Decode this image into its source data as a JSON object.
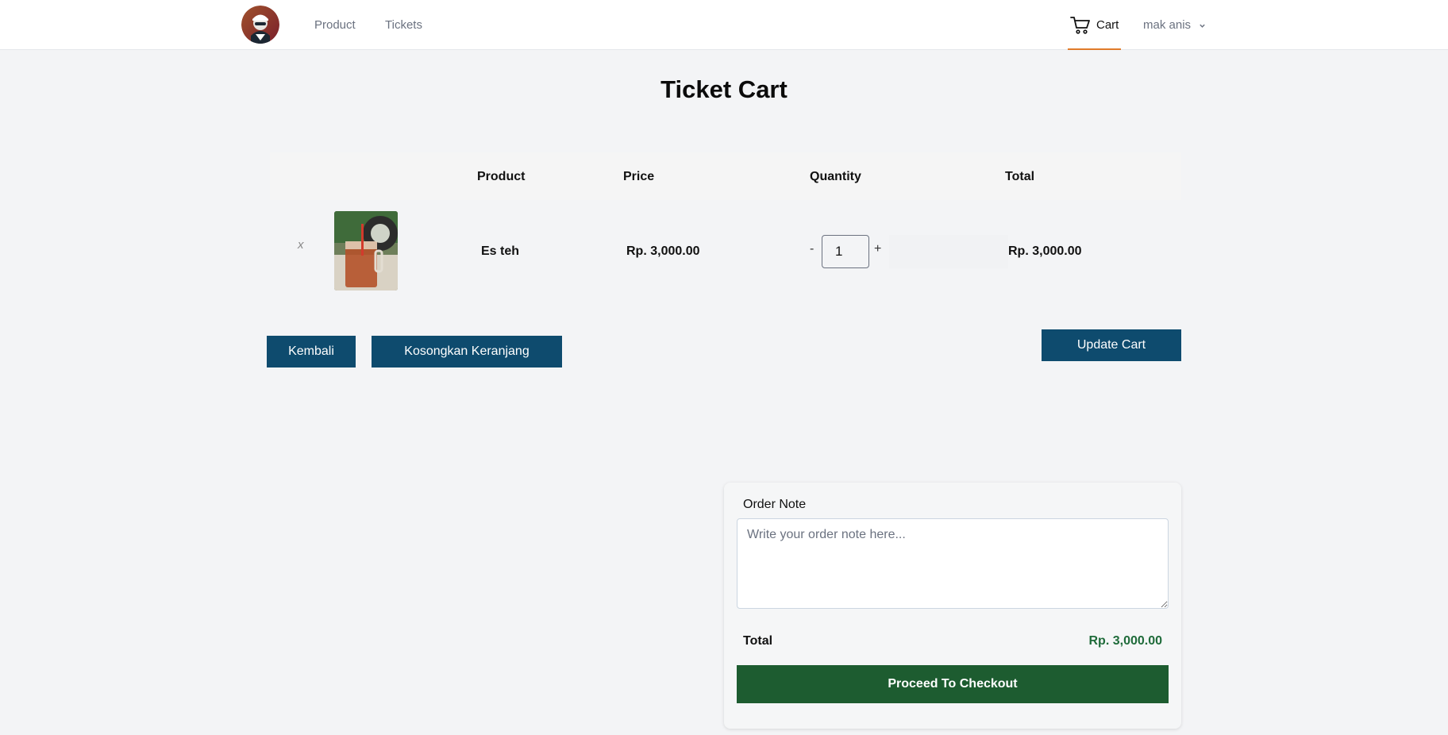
{
  "nav": {
    "product": "Product",
    "tickets": "Tickets",
    "cart": "Cart",
    "user": "mak anis"
  },
  "page": {
    "title": "Ticket Cart"
  },
  "table": {
    "headers": {
      "product": "Product",
      "price": "Price",
      "quantity": "Quantity",
      "total": "Total"
    },
    "rows": [
      {
        "remove": "x",
        "product": "Es teh",
        "price": "Rp. 3,000.00",
        "quantity": "1",
        "total": "Rp. 3,000.00"
      }
    ],
    "qty_minus": "-",
    "qty_plus": "+"
  },
  "actions": {
    "back": "Kembali",
    "clear": "Kosongkan Keranjang",
    "update": "Update Cart"
  },
  "summary": {
    "note_label": "Order Note",
    "note_placeholder": "Write your order note here...",
    "total_label": "Total",
    "total_value": "Rp. 3,000.00",
    "checkout": "Proceed To Checkout"
  },
  "colors": {
    "primary": "#0e4b6e",
    "checkout": "#1d5c30",
    "total_value": "#1f6b3a",
    "cart_underline": "#e07b2a"
  },
  "icons": {
    "logo": "avatar-logo",
    "cart": "cart-icon",
    "user_menu": "chevron-down-icon"
  }
}
